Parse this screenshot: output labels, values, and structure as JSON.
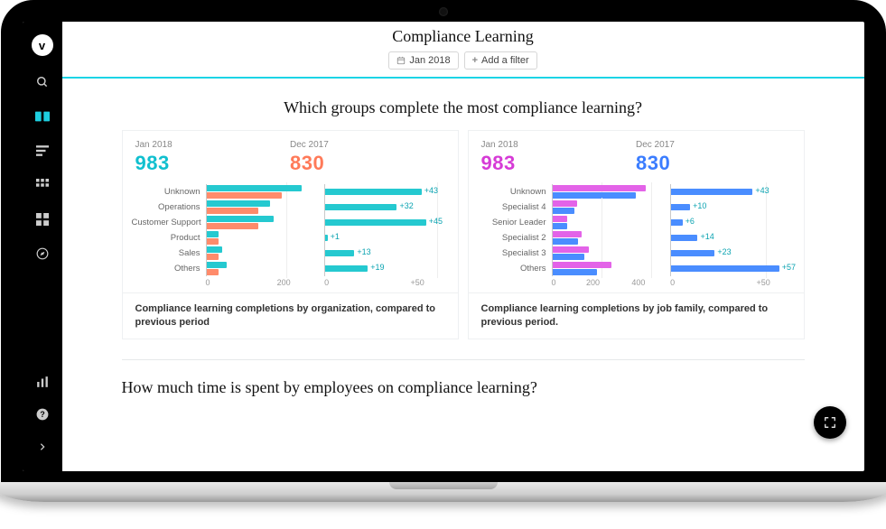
{
  "sidebar": {
    "logo": "v"
  },
  "header": {
    "title": "Compliance Learning",
    "filter_date": "Jan 2018",
    "add_filter": "Add a filter"
  },
  "question1": "Which groups complete the most compliance learning?",
  "question2": "How much time is spent by employees on compliance learning?",
  "card_left": {
    "stat_a": {
      "period": "Jan 2018",
      "value": "983"
    },
    "stat_b": {
      "period": "Dec 2017",
      "value": "830"
    },
    "caption": "Compliance learning completions by organization, compared to previous period"
  },
  "card_right": {
    "stat_a": {
      "period": "Jan 2018",
      "value": "983"
    },
    "stat_b": {
      "period": "Dec 2017",
      "value": "830"
    },
    "caption": "Compliance learning completions by job family, compared to previous period."
  },
  "chart_data": [
    {
      "type": "bar",
      "id": "org-current",
      "categories": [
        "Unknown",
        "Operations",
        "Customer Support",
        "Product",
        "Sales",
        "Others"
      ],
      "series": [
        {
          "name": "Jan 2018",
          "color": "#25c9d0",
          "values": [
            240,
            160,
            170,
            30,
            40,
            50
          ]
        },
        {
          "name": "Dec 2017",
          "color": "#ff8b6b",
          "values": [
            190,
            130,
            130,
            30,
            30,
            30
          ]
        }
      ],
      "xlim": [
        0,
        260
      ],
      "ticks": [
        0,
        200
      ]
    },
    {
      "type": "bar",
      "id": "org-delta",
      "categories": [
        "Unknown",
        "Operations",
        "Customer Support",
        "Product",
        "Sales",
        "Others"
      ],
      "series": [
        {
          "name": "Δ",
          "color": "#25c9d0",
          "values": [
            43,
            32,
            45,
            1,
            13,
            19
          ]
        }
      ],
      "value_prefix": "+",
      "xlim": [
        0,
        55
      ],
      "ticks": [
        0,
        50
      ]
    },
    {
      "type": "bar",
      "id": "jobfam-current",
      "categories": [
        "Unknown",
        "Specialist 4",
        "Senior Leader",
        "Specialist 2",
        "Specialist 3",
        "Others"
      ],
      "series": [
        {
          "name": "Jan 2018",
          "color": "#e363e8",
          "values": [
            380,
            100,
            60,
            120,
            150,
            240
          ]
        },
        {
          "name": "Dec 2017",
          "color": "#4a8dff",
          "values": [
            340,
            90,
            60,
            105,
            130,
            180
          ]
        }
      ],
      "xlim": [
        0,
        420
      ],
      "ticks": [
        0,
        200,
        400
      ]
    },
    {
      "type": "bar",
      "id": "jobfam-delta",
      "categories": [
        "Unknown",
        "Specialist 4",
        "Senior Leader",
        "Specialist 2",
        "Specialist 3",
        "Others"
      ],
      "series": [
        {
          "name": "Δ",
          "color": "#4a8dff",
          "values": [
            43,
            10,
            6,
            14,
            23,
            57
          ]
        }
      ],
      "value_prefix": "+",
      "xlim": [
        0,
        65
      ],
      "ticks": [
        0,
        50
      ]
    }
  ]
}
